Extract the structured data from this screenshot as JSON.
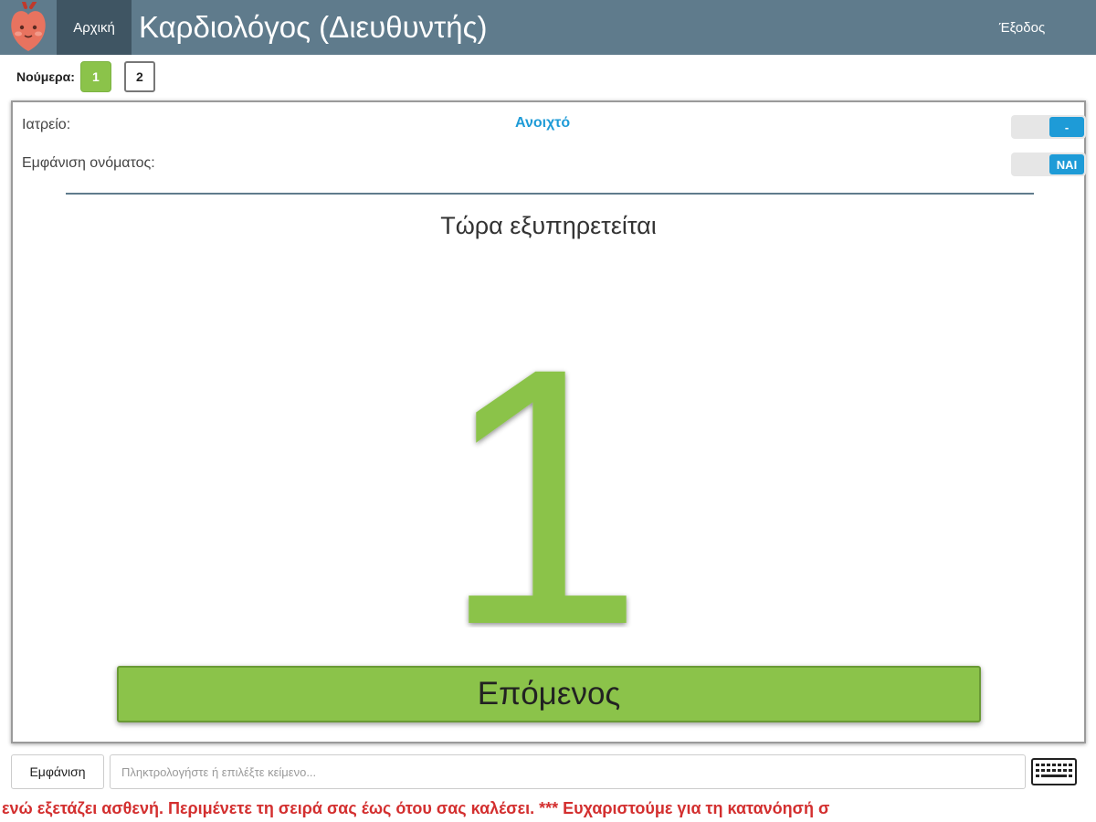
{
  "header": {
    "home_label": "Αρχική",
    "title": "Καρδιολόγος (Διευθυντής)",
    "logout_label": "Έξοδος"
  },
  "numbers": {
    "label": "Νούμερα:",
    "items": [
      {
        "label": "1",
        "active": true
      },
      {
        "label": "2",
        "active": false
      }
    ]
  },
  "panel": {
    "office_label": "Ιατρείο:",
    "office_status": "Ανοιχτό",
    "office_toggle_label": "-",
    "show_name_label": "Εμφάνιση ονόματος:",
    "show_name_toggle_label": "ΝΑΙ",
    "serving_label": "Τώρα εξυπηρετείται",
    "current_number": "1",
    "next_button_label": "Επόμενος"
  },
  "bottom": {
    "show_button_label": "Εμφάνιση",
    "input_placeholder": "Πληκτρολογήστε ή επιλέξτε κείμενο...",
    "input_value": "",
    "ticker_text": "ό ενώ εξετάζει ασθενή. Περιμένετε τη σειρά σας έως ότου σας καλέσει. *** Ευχαριστούμε για τη κατανόησή σ"
  },
  "colors": {
    "header_bg": "#5f7b8c",
    "active_tab_bg": "#3f5563",
    "accent_green": "#8bc34a",
    "accent_blue": "#1e9bd7",
    "alert_red": "#d32f2f"
  },
  "icons": {
    "logo": "heart-mascot-icon",
    "keyboard": "keyboard-icon"
  }
}
